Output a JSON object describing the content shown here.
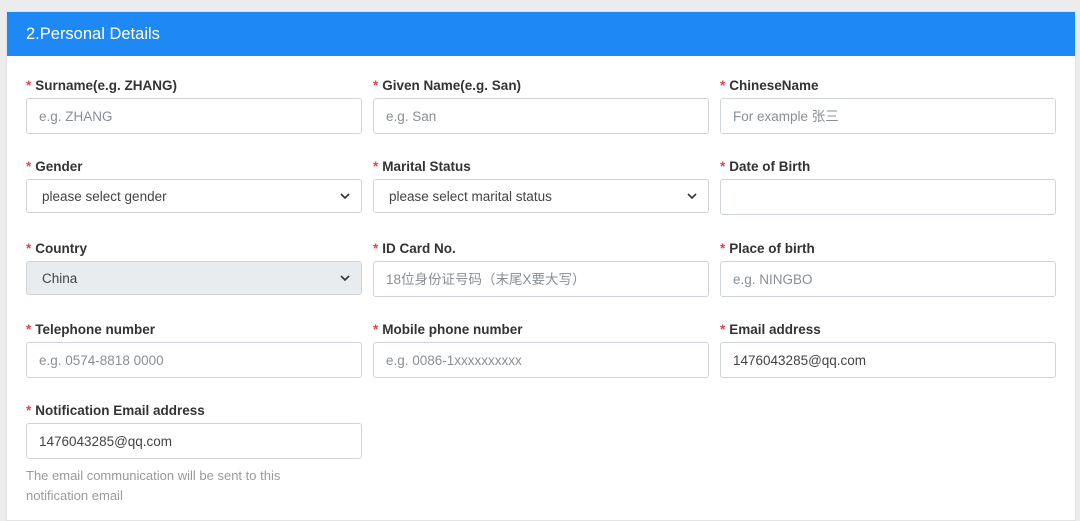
{
  "section": {
    "title": "2.Personal Details"
  },
  "fields": {
    "surname": {
      "label": "Surname(e.g. ZHANG)",
      "placeholder": "e.g. ZHANG",
      "value": ""
    },
    "given_name": {
      "label": "Given Name(e.g. San)",
      "placeholder": "e.g. San",
      "value": ""
    },
    "chinese_name": {
      "label": "ChineseName",
      "placeholder": "For example 张三",
      "value": ""
    },
    "gender": {
      "label": "Gender",
      "selected": "please select gender"
    },
    "marital_status": {
      "label": "Marital Status",
      "selected": "please select marital status"
    },
    "date_of_birth": {
      "label": "Date of Birth",
      "placeholder": "",
      "value": ""
    },
    "country": {
      "label": "Country",
      "selected": "China",
      "disabled": true
    },
    "id_card": {
      "label": "ID Card No.",
      "placeholder": "18位身份证号码（末尾X要大写）",
      "value": ""
    },
    "place_of_birth": {
      "label": "Place of birth",
      "placeholder": "e.g. NINGBO",
      "value": ""
    },
    "telephone": {
      "label": "Telephone number",
      "placeholder": "e.g. 0574-8818 0000",
      "value": ""
    },
    "mobile": {
      "label": "Mobile phone number",
      "placeholder": "e.g. 0086-1xxxxxxxxxx",
      "value": ""
    },
    "email": {
      "label": "Email address",
      "placeholder": "",
      "value": "1476043285@qq.com"
    },
    "notification_email": {
      "label": "Notification Email address",
      "placeholder": "",
      "value": "1476043285@qq.com",
      "hint": "The email communication will be sent to this notification email"
    }
  },
  "required_marker": "*",
  "colors": {
    "header_bg": "#1e88f5",
    "required": "#e04646",
    "disabled_bg": "#e9ecef"
  }
}
